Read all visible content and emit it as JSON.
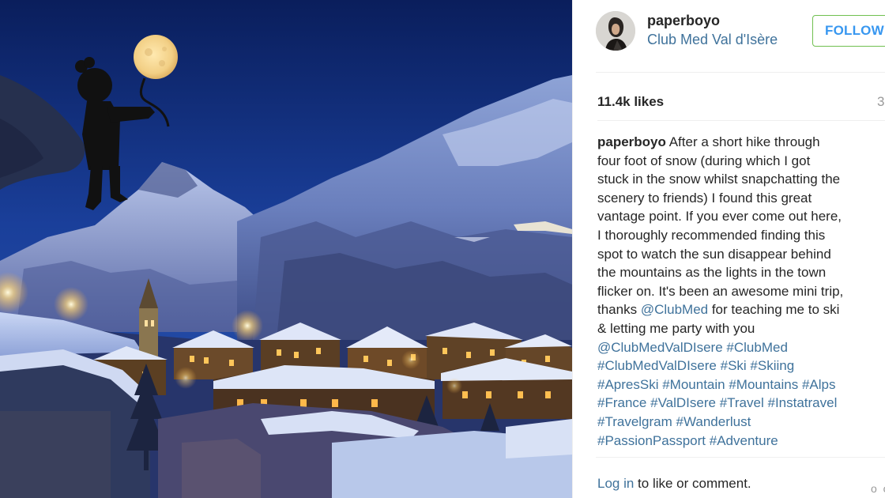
{
  "post": {
    "username": "paperboyo",
    "location": "Club Med Val d'Isère",
    "follow_label": "FOLLOW",
    "likes": "11.4k likes",
    "time_fragment": "3",
    "caption": {
      "username": "paperboyo",
      "lines": [
        [
          {
            "t": "After a short hike through",
            "tag": false
          }
        ],
        [
          {
            "t": "four foot of snow (during which I got",
            "tag": false
          }
        ],
        [
          {
            "t": "stuck in the snow whilst snapchatting the",
            "tag": false
          }
        ],
        [
          {
            "t": "scenery to friends) I found this great",
            "tag": false
          }
        ],
        [
          {
            "t": "vantage point. If you ever come out here,",
            "tag": false
          }
        ],
        [
          {
            "t": "I thoroughly recommended finding this",
            "tag": false
          }
        ],
        [
          {
            "t": "spot to watch the sun disappear behind",
            "tag": false
          }
        ],
        [
          {
            "t": "the mountains as the lights in the town",
            "tag": false
          }
        ],
        [
          {
            "t": "flicker on. It's been an awesome mini trip,",
            "tag": false
          }
        ],
        [
          {
            "t": "thanks ",
            "tag": false
          },
          {
            "t": "@ClubMed",
            "tag": true
          },
          {
            "t": " for teaching me to ski",
            "tag": false
          }
        ],
        [
          {
            "t": "& letting me party with you",
            "tag": false
          }
        ],
        [
          {
            "t": "@ClubMedValDIsere",
            "tag": true
          },
          {
            "t": " ",
            "tag": false
          },
          {
            "t": "#ClubMed",
            "tag": true
          }
        ],
        [
          {
            "t": "#ClubMedValDIsere",
            "tag": true
          },
          {
            "t": " ",
            "tag": false
          },
          {
            "t": "#Ski",
            "tag": true
          },
          {
            "t": " ",
            "tag": false
          },
          {
            "t": "#Skiing",
            "tag": true
          }
        ],
        [
          {
            "t": "#ApresSki",
            "tag": true
          },
          {
            "t": " ",
            "tag": false
          },
          {
            "t": "#Mountain",
            "tag": true
          },
          {
            "t": " ",
            "tag": false
          },
          {
            "t": "#Mountains",
            "tag": true
          },
          {
            "t": " ",
            "tag": false
          },
          {
            "t": "#Alps",
            "tag": true
          }
        ],
        [
          {
            "t": "#France",
            "tag": true
          },
          {
            "t": " ",
            "tag": false
          },
          {
            "t": "#ValDIsere",
            "tag": true
          },
          {
            "t": " ",
            "tag": false
          },
          {
            "t": "#Travel",
            "tag": true
          },
          {
            "t": " ",
            "tag": false
          },
          {
            "t": "#Instatravel",
            "tag": true
          }
        ],
        [
          {
            "t": "#Travelgram",
            "tag": true
          },
          {
            "t": " ",
            "tag": false
          },
          {
            "t": "#Wanderlust",
            "tag": true
          }
        ],
        [
          {
            "t": "#PassionPassport",
            "tag": true
          },
          {
            "t": " ",
            "tag": false
          },
          {
            "t": "#Adventure",
            "tag": true
          }
        ]
      ]
    },
    "login_link": "Log in",
    "login_rest": " to like or comment.",
    "more_label": "o o"
  },
  "colors": {
    "link": "#3f729b",
    "follow_text": "#3897f0",
    "follow_border": "#70c050",
    "text": "#262626"
  },
  "icons": {
    "avatar": "avatar-photo",
    "more": "more-options-icon"
  }
}
